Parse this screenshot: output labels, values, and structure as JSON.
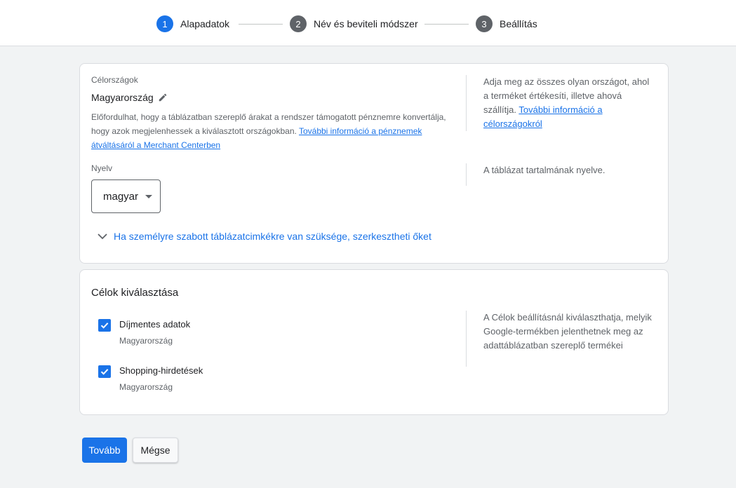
{
  "stepper": {
    "steps": [
      {
        "num": "1",
        "label": "Alapadatok"
      },
      {
        "num": "2",
        "label": "Név és beviteli módszer"
      },
      {
        "num": "3",
        "label": "Beállítás"
      }
    ]
  },
  "countries": {
    "label": "Célországok",
    "value": "Magyarország",
    "helper_text": "Előfordulhat, hogy a táblázatban szereplő árakat a rendszer támogatott pénznemre konvertálja, hogy azok megjelenhessek a kiválasztott országokban.",
    "helper_link": "További információ a pénznemek átváltásáról a Merchant Centerben",
    "side_text": "Adja meg az összes olyan országot, ahol a terméket értékesíti, illetve ahová szállítja.",
    "side_link": "További információ a célországokról"
  },
  "language": {
    "label": "Nyelv",
    "value": "magyar",
    "side_text": "A táblázat tartalmának nyelve."
  },
  "expand_text": "Ha személyre szabott táblázatcimkékre van szüksége, szerkesztheti őket",
  "goals": {
    "title": "Célok kiválasztása",
    "side_text": "A Célok beállításnál kiválaszthatja, melyik Google-termékben jelenthetnek meg az adattáblázatban szereplő termékei",
    "items": [
      {
        "label": "Díjmentes adatok",
        "sub": "Magyarország",
        "checked": true
      },
      {
        "label": "Shopping-hirdetések",
        "sub": "Magyarország",
        "checked": true
      }
    ]
  },
  "buttons": {
    "next": "Tovább",
    "cancel": "Mégse"
  },
  "colors": {
    "accent": "#1a73e8",
    "background": "#f1f3f4"
  }
}
